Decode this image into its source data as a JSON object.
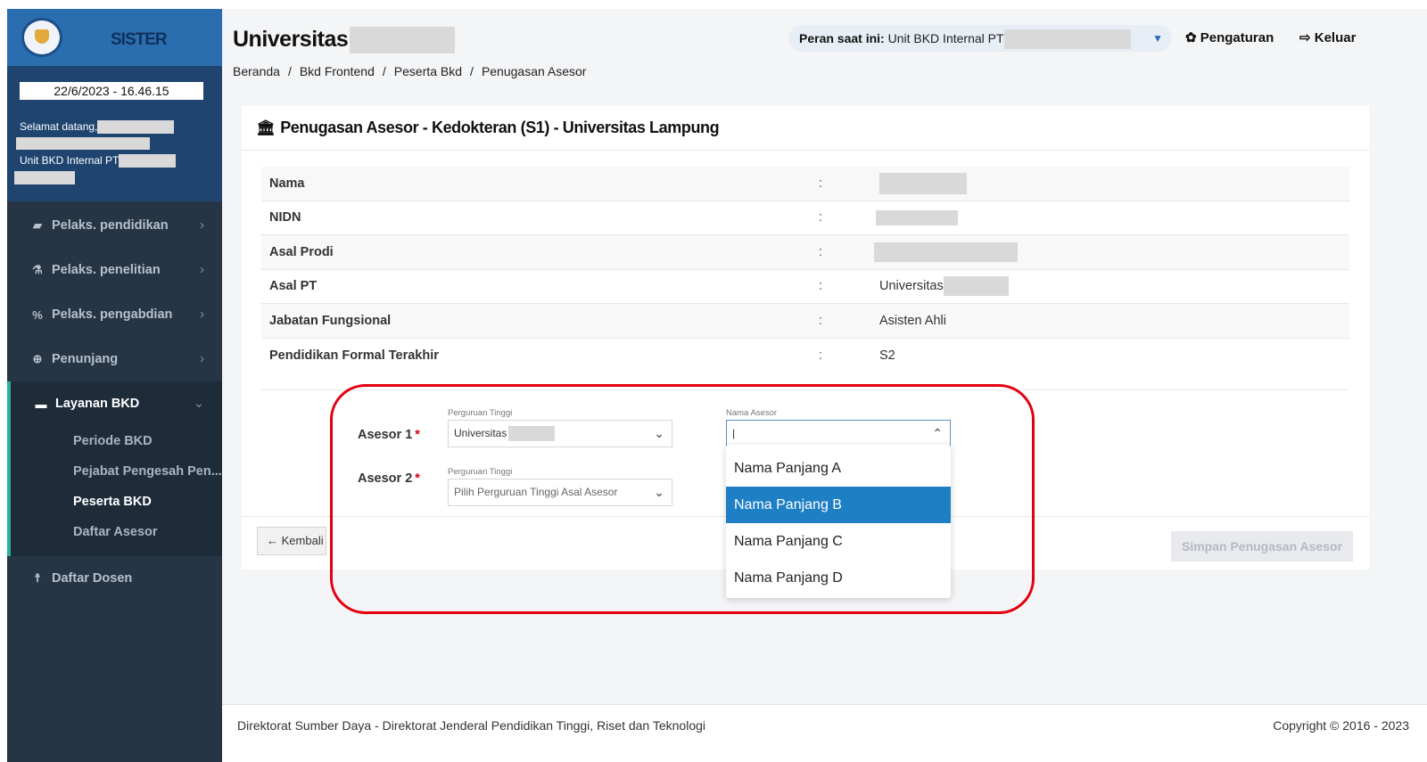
{
  "sidebar": {
    "brand": "SISTER",
    "datetime": "22/6/2023 - 16.46.15",
    "welcome": "Selamat datang,",
    "unit": "Unit BKD Internal PT",
    "nav": [
      {
        "label": "Pelaks. pendidikan",
        "icon": "book-icon"
      },
      {
        "label": "Pelaks. penelitian",
        "icon": "flask-icon"
      },
      {
        "label": "Pelaks. pengabdian",
        "icon": "link-icon"
      },
      {
        "label": "Penunjang",
        "icon": "lifebuoy-icon"
      }
    ],
    "open_section": {
      "label": "Layanan BKD",
      "icon": "briefcase-icon",
      "items": [
        "Periode BKD",
        "Pejabat Pengesah Pen...",
        "Peserta BKD",
        "Daftar Asesor"
      ],
      "active": "Peserta BKD"
    },
    "bottom_item": {
      "label": "Daftar Dosen",
      "icon": "person-icon"
    }
  },
  "header": {
    "title": "Universitas",
    "breadcrumb": [
      "Beranda",
      "Bkd Frontend",
      "Peserta Bkd",
      "Penugasan Asesor"
    ],
    "role_label": "Peran saat ini:",
    "role_value": "Unit BKD Internal PT",
    "settings": "Pengaturan",
    "logout": "Keluar"
  },
  "card": {
    "title": "Penugasan Asesor - Kedokteran (S1) - Universitas Lampung",
    "info": [
      {
        "label": "Nama",
        "value": ""
      },
      {
        "label": "NIDN",
        "value": ""
      },
      {
        "label": "Asal Prodi",
        "value": ""
      },
      {
        "label": "Asal PT",
        "value": "Universitas"
      },
      {
        "label": "Jabatan Fungsional",
        "value": "Asisten Ahli"
      },
      {
        "label": "Pendidikan Formal Terakhir",
        "value": "S2"
      }
    ],
    "colon": ":",
    "asesor1": {
      "label": "Asesor 1",
      "pt_label": "Perguruan Tinggi",
      "pt_value": "Universitas",
      "nama_label": "Nama Asesor",
      "nama_value": ""
    },
    "asesor2": {
      "label": "Asesor 2",
      "pt_label": "Perguruan Tinggi",
      "pt_placeholder": "Pilih Perguruan Tinggi Asal Asesor"
    },
    "required_mark": "*",
    "dropdown_options": [
      "Nama Panjang A",
      "Nama Panjang B",
      "Nama Panjang C",
      "Nama Panjang D"
    ],
    "dropdown_selected": "Nama Panjang B",
    "back_button": "Kembali",
    "save_button": "Simpan Penugasan Asesor"
  },
  "footer": {
    "left": "Direktorat Sumber Daya - Direktorat Jenderal Pendidikan Tinggi, Riset dan Teknologi",
    "right": "Copyright © 2016 - 2023"
  },
  "colors": {
    "sidebar": "#253545",
    "brand": "#2a6eb0",
    "accent": "#2cb39e",
    "selected": "#1f7fc5",
    "highlight": "#e3000f"
  }
}
